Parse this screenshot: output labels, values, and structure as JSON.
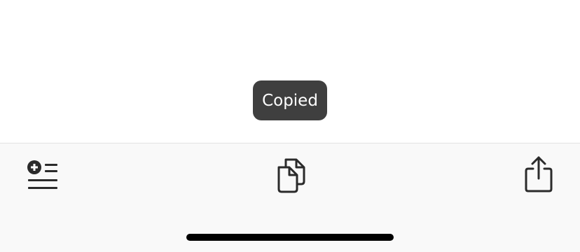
{
  "toast": {
    "text": "Copied"
  },
  "toolbar": {
    "buttons": [
      {
        "icon": "add-list-icon"
      },
      {
        "icon": "copy-icon"
      },
      {
        "icon": "share-icon"
      }
    ]
  },
  "colors": {
    "toast_background": "#3f3f3f",
    "toast_text": "#ffffff",
    "toolbar_background": "#f9f9f9",
    "icon": "#2b2b2b",
    "home_indicator": "#000000"
  }
}
